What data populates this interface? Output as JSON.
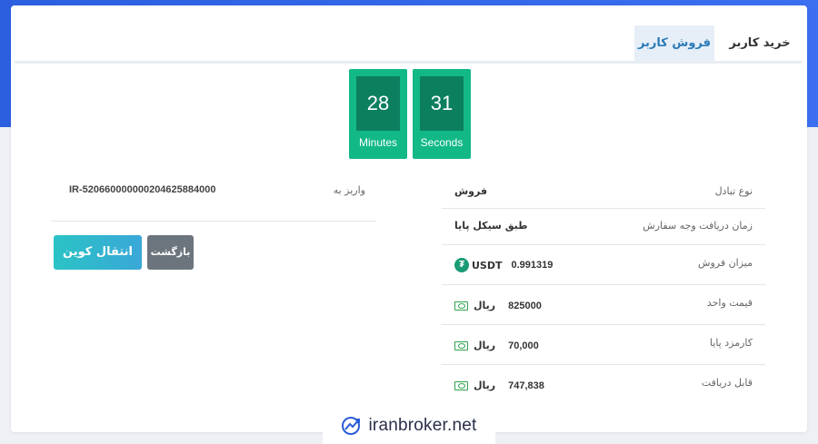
{
  "tabs": {
    "buy": "خرید کاربر",
    "sell": "فروش کاربر"
  },
  "timer": {
    "minutes": "28",
    "minutes_label": "Minutes",
    "seconds": "31",
    "seconds_label": "Seconds"
  },
  "deposit": {
    "label": "واریز به",
    "iban": "IR-520660000000204625884000"
  },
  "buttons": {
    "transfer": "انتقال کوین",
    "back": "بازگشت"
  },
  "details": [
    {
      "label": "نوع تبادل",
      "value": "فروش"
    },
    {
      "label": "زمان دریافت وجه سفارش",
      "value": "طبق سیکل پایا"
    },
    {
      "label": "میزان فروش",
      "amount": "0.991319",
      "unit": "USDT",
      "icon": "tether-icon"
    },
    {
      "label": "قیمت واحد",
      "amount": "825000",
      "unit": "ریال",
      "icon": "cash-icon"
    },
    {
      "label": "کارمزد پایا",
      "amount": "70,000",
      "unit": "ریال",
      "icon": "cash-icon"
    },
    {
      "label": "قابل دریافت",
      "amount": "747,838",
      "unit": "ریال",
      "icon": "cash-icon"
    }
  ],
  "watermark": {
    "text": "iranbroker.net",
    "icon": "chart-logo-icon"
  },
  "colors": {
    "timer_bg": "#12b986",
    "timer_digit_bg": "#0c7f5f",
    "accent_blue": "#2c5fe0",
    "transfer_button": "#2ac3c5",
    "back_button": "#6c757d"
  }
}
